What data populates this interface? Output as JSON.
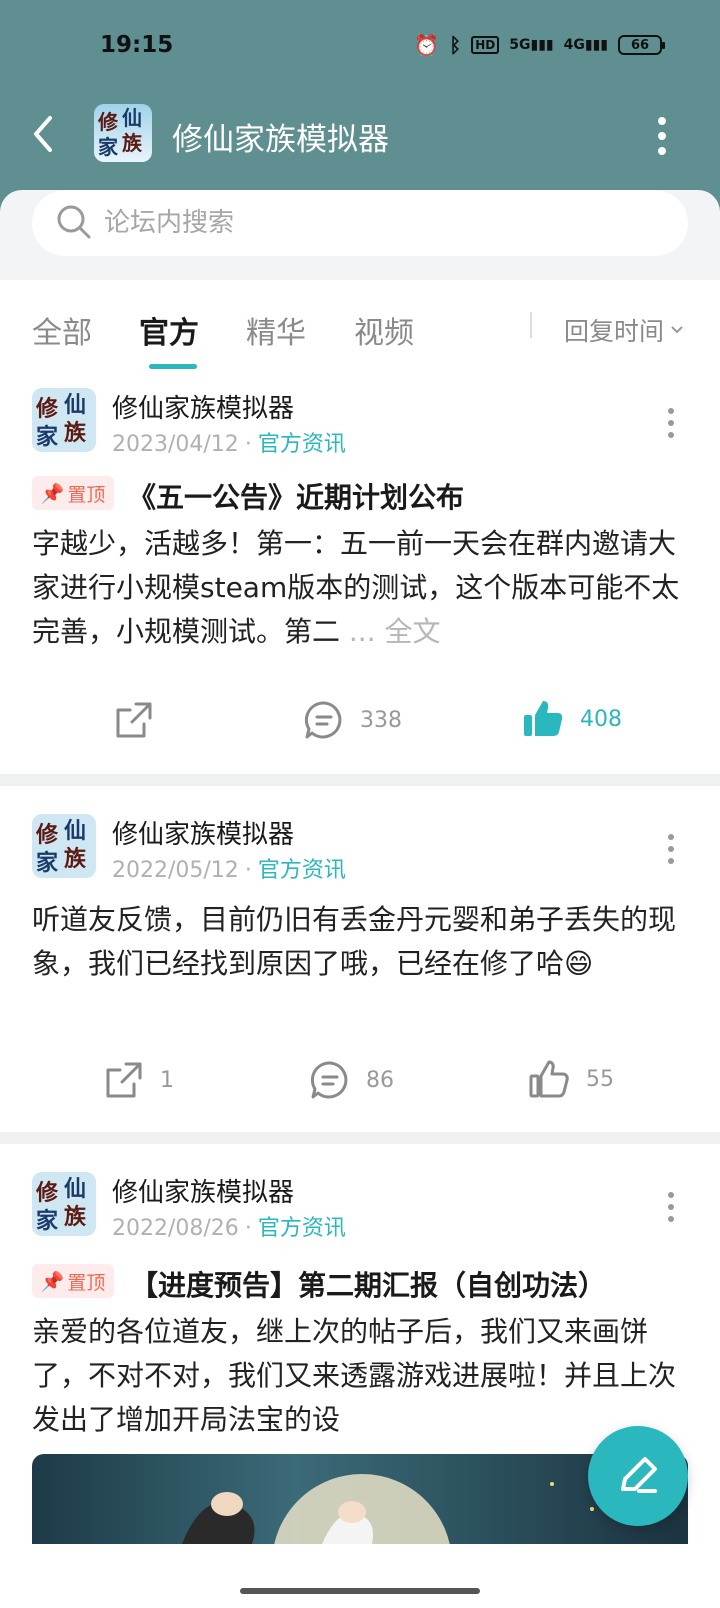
{
  "status": {
    "time": "19:15",
    "hd": "HD",
    "net1": "5G",
    "net2": "4G",
    "battery": "66"
  },
  "header": {
    "title": "修仙家族模拟器",
    "logo_text": [
      "修",
      "仙",
      "家",
      "族"
    ]
  },
  "search": {
    "placeholder": "论坛内搜索"
  },
  "tabs": [
    {
      "label": "全部"
    },
    {
      "label": "官方"
    },
    {
      "label": "精华"
    },
    {
      "label": "视频"
    }
  ],
  "sort": {
    "label": "回复时间"
  },
  "posts": [
    {
      "author": "修仙家族模拟器",
      "date": "2023/04/12",
      "category": "官方资讯",
      "pin": "置顶",
      "title": "《五一公告》近期计划公布",
      "body": "字越少，活越多！第一：五一前一天会在群内邀请大家进行小规模steam版本的测试，这个版本可能不太完善，小规模测试。第二 ",
      "more": "... 全文",
      "share": "",
      "comments": "338",
      "likes": "408"
    },
    {
      "author": "修仙家族模拟器",
      "date": "2022/05/12",
      "category": "官方资讯",
      "body": "听道友反馈，目前仍旧有丢金丹元婴和弟子丢失的现象，我们已经找到原因了哦，已经在修了哈😄",
      "share": "1",
      "comments": "86",
      "likes": "55"
    },
    {
      "author": "修仙家族模拟器",
      "date": "2022/08/26",
      "category": "官方资讯",
      "pin": "置顶",
      "title": "【进度预告】第二期汇报（自创功法）",
      "body": "亲爱的各位道友，继上次的帖子后，我们又来画饼了，不对不对，我们又来透露游戏进展啦！并且上次发出了增加开局法宝的设"
    }
  ],
  "colors": {
    "accent": "#2ab7bd",
    "header_bg": "#5f8f90",
    "pin": "#ef6a55"
  }
}
